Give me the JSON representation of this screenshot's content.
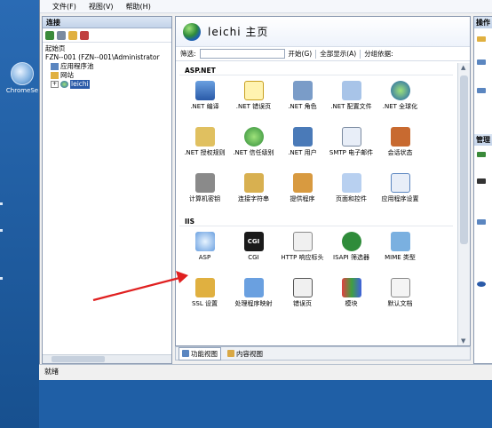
{
  "desktop": {
    "icon_label": "ChromeSe"
  },
  "menu": [
    "文件(F)",
    "视图(V)",
    "帮助(H)"
  ],
  "left_pane": {
    "title": "连接",
    "tree": {
      "start_page": "起始页",
      "server": "FZN--001 (FZN--001\\Administrator",
      "app_pools": "应用程序池",
      "sites": "网站",
      "site": "leichi"
    }
  },
  "main": {
    "title": "leichi 主页",
    "filter_label": "筛选:",
    "start_label": "开始(G)",
    "show_all_label": "全部显示(A)",
    "group_label": "分组依据:",
    "sections": [
      {
        "title": "ASP.NET",
        "items": [
          {
            "label": ".NET 编译",
            "icon": "net-compile-icon"
          },
          {
            "label": ".NET 错误页",
            "icon": "net-error-page-icon"
          },
          {
            "label": ".NET 角色",
            "icon": "net-roles-icon"
          },
          {
            "label": ".NET 配置文件",
            "icon": "net-profile-icon"
          },
          {
            "label": ".NET 全球化",
            "icon": "net-globalization-icon"
          },
          {
            "label": ".NET 授权规则",
            "icon": "net-authorization-icon"
          },
          {
            "label": ".NET 信任级别",
            "icon": "net-trust-levels-icon"
          },
          {
            "label": ".NET 用户",
            "icon": "net-users-icon"
          },
          {
            "label": "SMTP 电子邮件",
            "icon": "smtp-email-icon"
          },
          {
            "label": "会话状态",
            "icon": "session-state-icon"
          },
          {
            "label": "计算机密钥",
            "icon": "machine-key-icon"
          },
          {
            "label": "连接字符串",
            "icon": "connection-strings-icon"
          },
          {
            "label": "提供程序",
            "icon": "providers-icon"
          },
          {
            "label": "页面和控件",
            "icon": "pages-controls-icon"
          },
          {
            "label": "应用程序设置",
            "icon": "app-settings-icon"
          }
        ]
      },
      {
        "title": "IIS",
        "items": [
          {
            "label": "ASP",
            "icon": "asp-icon"
          },
          {
            "label": "CGI",
            "icon": "cgi-icon"
          },
          {
            "label": "HTTP 响应标头",
            "icon": "http-response-headers-icon"
          },
          {
            "label": "ISAPI 筛选器",
            "icon": "isapi-filters-icon"
          },
          {
            "label": "MIME 类型",
            "icon": "mime-types-icon"
          },
          {
            "label": "SSL 设置",
            "icon": "ssl-settings-icon"
          },
          {
            "label": "处理程序映射",
            "icon": "handler-mappings-icon"
          },
          {
            "label": "错误页",
            "icon": "error-pages-icon"
          },
          {
            "label": "模块",
            "icon": "modules-icon"
          },
          {
            "label": "默认文档",
            "icon": "default-document-icon"
          }
        ]
      }
    ]
  },
  "view_tabs": {
    "features": "功能视图",
    "content": "内容视图"
  },
  "right_pane": {
    "title": "操作",
    "title2": "管理"
  },
  "status": "就绪",
  "colors": {
    "selection": "#2a5aa8",
    "arrow": "#e02020"
  }
}
